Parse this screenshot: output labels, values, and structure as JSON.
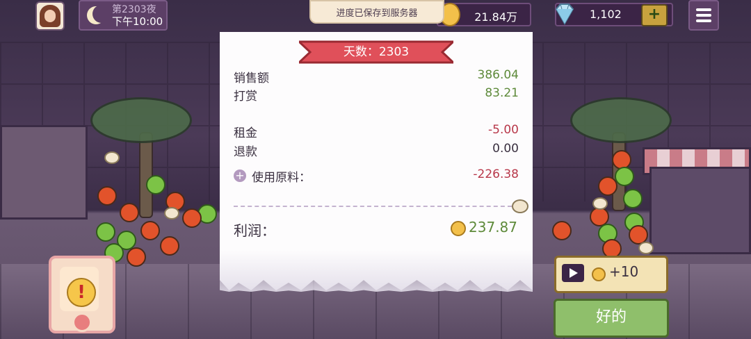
{
  "header": {
    "day_label": "第2303夜",
    "time_label": "下午10:00",
    "toast": "进度已保存到服务器",
    "coins": "21.84万",
    "gems": "1,102",
    "add_label": "+"
  },
  "receipt": {
    "title": "天数：2303",
    "rows": [
      {
        "label": "销售额",
        "value": "386.04"
      },
      {
        "label": "打赏",
        "value": "83.21"
      },
      {
        "label": "租金",
        "value": "-5.00"
      },
      {
        "label": "退款",
        "value": "0.00"
      },
      {
        "label": "使用原料：",
        "value": "-226.38"
      }
    ],
    "profit_label": "利润：",
    "profit_value": "237.87"
  },
  "actions": {
    "ad_reward": "+10",
    "ok_label": "好的",
    "alert_mark": "!"
  },
  "icons": [
    "moon-icon",
    "coin-icon",
    "gem-icon",
    "menu-icon",
    "play-icon",
    "plus-circle-icon",
    "alert-icon"
  ],
  "colors": {
    "positive": "#5e8a3a",
    "negative": "#b8384a",
    "ribbon": "#e0505a",
    "ok_button": "#8fbf6b"
  }
}
